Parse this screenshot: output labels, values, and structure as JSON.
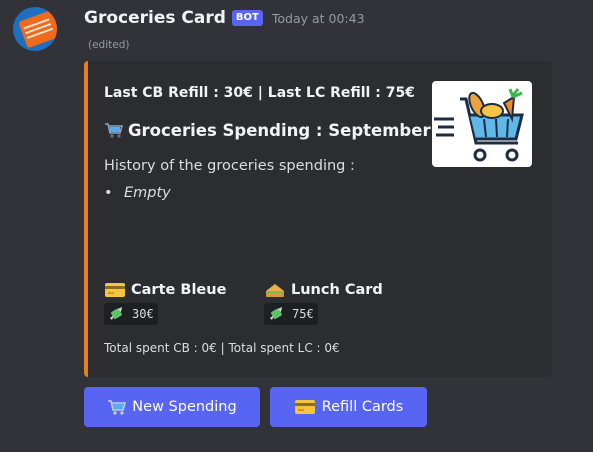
{
  "message": {
    "author": "Groceries Card",
    "bot_badge": "BOT",
    "timestamp": "Today at 00:43",
    "edited": "(edited)"
  },
  "embed": {
    "accent_color": "#e67e22",
    "refill_line": "Last CB Refill : 30€ | Last LC Refill : 75€",
    "title": "Groceries Spending : September",
    "description": "History of the groceries spending :",
    "history_items": [
      "Empty"
    ],
    "fields": [
      {
        "icon": "credit-card-icon",
        "name": "Carte Bleue",
        "value": "30€"
      },
      {
        "icon": "sandwich-icon",
        "name": "Lunch Card",
        "value": "75€"
      }
    ],
    "footer": "Total spent CB : 0€ | Total spent LC : 0€",
    "thumbnail": "grocery-cart-icon"
  },
  "buttons": [
    {
      "icon": "shopping-cart-icon",
      "label": "New Spending"
    },
    {
      "icon": "credit-card-icon",
      "label": "Refill Cards"
    }
  ],
  "colors": {
    "background": "#313338",
    "embed_bg": "#2b2d31",
    "button": "#5865f2",
    "badge": "#5865f2"
  }
}
